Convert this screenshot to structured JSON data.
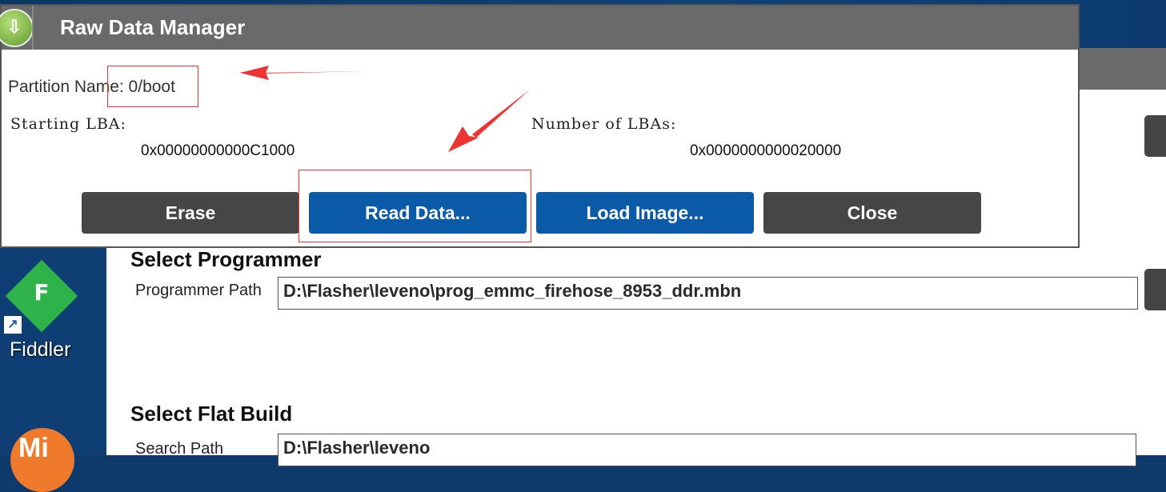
{
  "dialog": {
    "title": "Raw Data Manager",
    "partition_label": "Partition Name: 0/boot",
    "starting_lba_label": "Starting LBA:",
    "starting_lba_value": "0x00000000000C1000",
    "num_lbas_label": "Number of LBAs:",
    "num_lbas_value": "0x0000000000020000",
    "buttons": {
      "erase": "Erase",
      "read": "Read Data...",
      "load": "Load Image...",
      "close": "Close"
    }
  },
  "app": {
    "programmer_section": "Select Programmer",
    "programmer_label": "Programmer Path",
    "programmer_path": "D:\\Flasher\\leveno\\prog_emmc_firehose_8953_ddr.mbn",
    "flat_build_section": "Select Flat Build",
    "search_label": "Search Path",
    "search_path": "D:\\Flasher\\leveno"
  },
  "desktop": {
    "fiddler_label": "Fiddler",
    "fiddler_letter": "F",
    "mi_text": "Mi"
  },
  "colors": {
    "annotation": "#e33333",
    "button_blue": "#0a5aa8",
    "button_dark": "#464646"
  }
}
